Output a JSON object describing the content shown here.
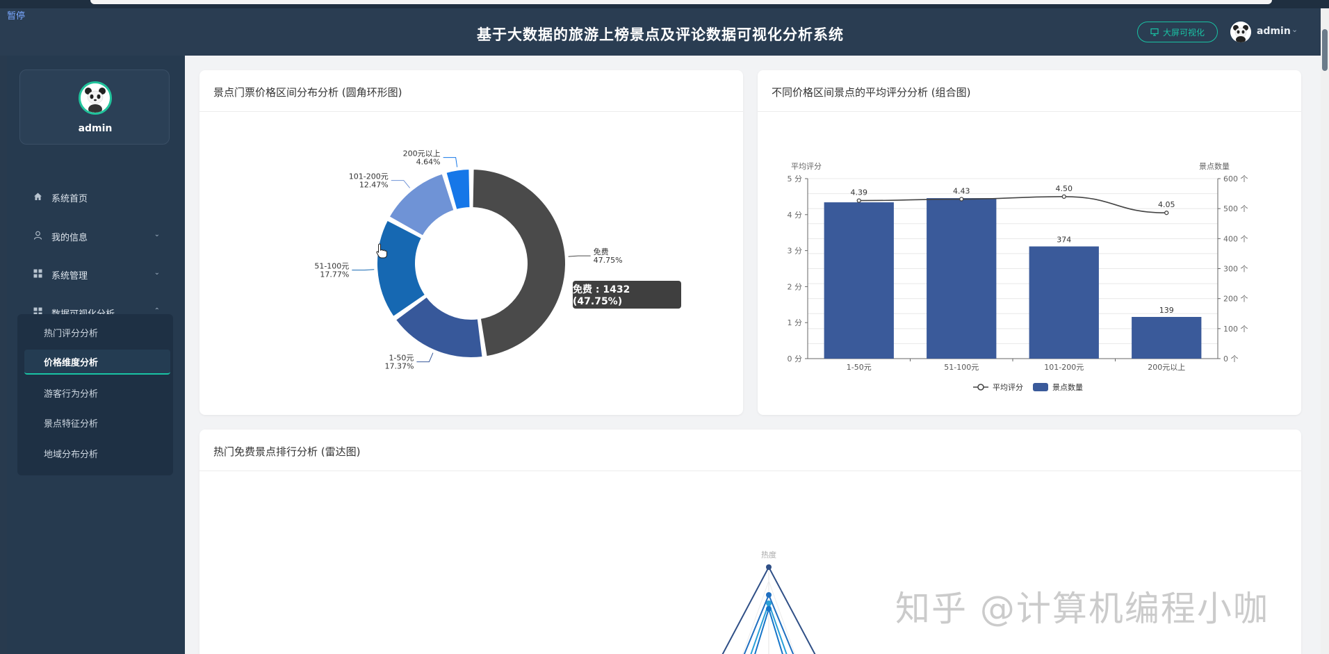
{
  "overlay": {
    "paused_label": "暂停"
  },
  "header": {
    "title": "基于大数据的旅游上榜景点及评论数据可视化分析系统",
    "bigscreen_button": "大屏可视化",
    "username": "admin"
  },
  "sidebar": {
    "profile_name": "admin",
    "menu": [
      {
        "label": "系统首页",
        "icon": "home-icon"
      },
      {
        "label": "我的信息",
        "icon": "user-icon"
      },
      {
        "label": "系统管理",
        "icon": "grid-icon"
      },
      {
        "label": "数据可视化分析",
        "icon": "grid-icon"
      }
    ],
    "submenu": [
      {
        "label": "热门评分分析"
      },
      {
        "label": "价格维度分析",
        "active": true
      },
      {
        "label": "游客行为分析"
      },
      {
        "label": "景点特征分析"
      },
      {
        "label": "地域分布分析"
      }
    ]
  },
  "cards": {
    "donut_title": "景点门票价格区间分布分析 (圆角环形图)",
    "combo_title": "不同价格区间景点的平均评分分析 (组合图)",
    "radar_title": "热门免费景点排行分析 (雷达图)"
  },
  "tooltip": {
    "text": "免费 : 1432 (47.75%)"
  },
  "watermark": "知乎 @计算机编程小咖",
  "colors": {
    "accent": "#19c3a4",
    "header_bg": "#2a3d52",
    "sidebar_bg": "#263a4f",
    "bar": "#3a5a9a",
    "free_slice": "#4a4a4a"
  },
  "chart_data": [
    {
      "type": "pie",
      "variant": "rounded-donut",
      "title": "景点门票价格区间分布分析 (圆角环形图)",
      "slices": [
        {
          "label": "免费",
          "percent": 47.75,
          "value": 1432,
          "percent_label": "47.75%",
          "color": "#4a4a4a"
        },
        {
          "label": "1-50元",
          "percent": 17.37,
          "percent_label": "17.37%",
          "color": "#37589a"
        },
        {
          "label": "51-100元",
          "percent": 17.77,
          "percent_label": "17.77%",
          "color": "#1668b2"
        },
        {
          "label": "101-200元",
          "percent": 12.47,
          "percent_label": "12.47%",
          "color": "#6f93d6"
        },
        {
          "label": "200元以上",
          "percent": 4.64,
          "percent_label": "4.64%",
          "color": "#1677e8"
        }
      ]
    },
    {
      "type": "bar",
      "variant": "bar+line dual-axis",
      "title": "不同价格区间景点的平均评分分析 (组合图)",
      "categories": [
        "1-50元",
        "51-100元",
        "101-200元",
        "200元以上"
      ],
      "series": [
        {
          "name": "景点数量",
          "kind": "bar",
          "axis": "right",
          "values": [
            521,
            535,
            374,
            139
          ],
          "labels": [
            "",
            "",
            "374",
            "139"
          ]
        },
        {
          "name": "平均评分",
          "kind": "line",
          "axis": "left",
          "values": [
            4.39,
            4.43,
            4.5,
            4.05
          ],
          "labels": [
            "4.39",
            "4.43",
            "4.50",
            "4.05"
          ]
        }
      ],
      "ylabel_left": "平均评分",
      "ylabel_right": "景点数量",
      "yticks_left": [
        "0 分",
        "1 分",
        "2 分",
        "3 分",
        "4 分",
        "5 分"
      ],
      "yticks_right": [
        "0 个",
        "100 个",
        "200 个",
        "300 个",
        "400 个",
        "500 个",
        "600 个"
      ],
      "ylim_left": [
        0,
        5
      ],
      "ylim_right": [
        0,
        600
      ],
      "legend": [
        "平均评分",
        "景点数量"
      ],
      "legend_position": "bottom-center"
    },
    {
      "type": "radar",
      "title": "热门免费景点排行分析 (雷达图)",
      "indicator_visible": "热度"
    }
  ]
}
